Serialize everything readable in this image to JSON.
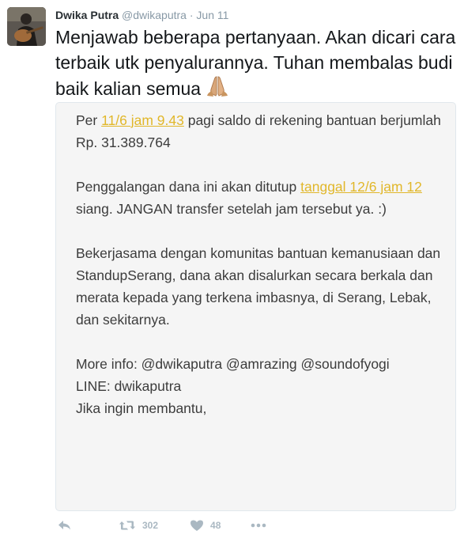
{
  "tweet": {
    "author_name": "Dwika Putra",
    "handle": "@dwikaputra",
    "separator": "·",
    "date": "Jun 11",
    "text": "Menjawab beberapa pertanyaan. Akan dicari cara terbaik utk penyalurannya. Tuhan membalas budi baik kalian semua",
    "emoji_icon": "folded-hands-icon"
  },
  "note": {
    "p1_prefix": "Per ",
    "p1_link": "11/6 jam 9.43",
    "p1_suffix": " pagi saldo di rekening bantuan berjumlah Rp. 31.389.764",
    "p2_prefix": "Penggalangan dana ini akan ditutup ",
    "p2_link": "tanggal 12/6 jam 12",
    "p2_suffix": " siang. JANGAN transfer setelah jam tersebut ya. :)",
    "p3": "Bekerjasama dengan komunitas bantuan kemanusiaan dan StandupSerang, dana akan disalurkan secara berkala dan merata kepada yang terkena imbasnya, di Serang, Lebak, dan sekitarnya.",
    "p4_line1": "More info: @dwikaputra @amrazing @soundofyogi",
    "p4_line2": "LINE: dwikaputra",
    "p5_clipped": "Jika ingin membantu,"
  },
  "actions": {
    "retweet_count": "302",
    "like_count": "48",
    "highlight_color": "#e1b72a",
    "icon_color": "#aab8c2"
  }
}
